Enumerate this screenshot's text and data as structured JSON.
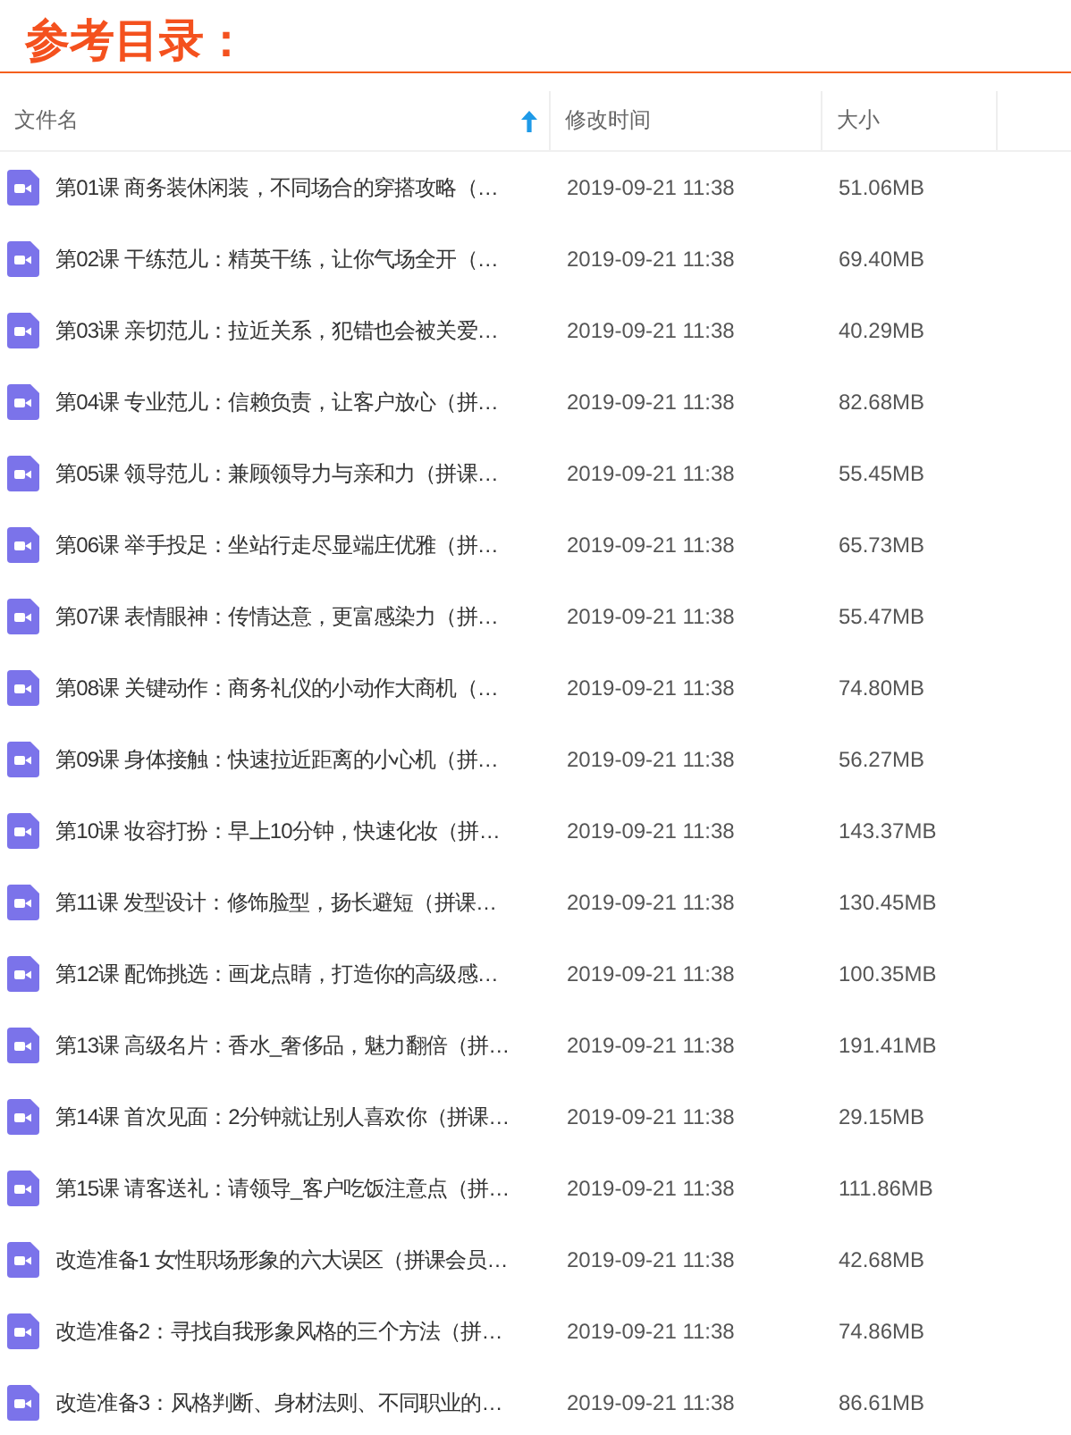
{
  "title": "参考目录：",
  "table": {
    "columns": [
      {
        "label": "文件名",
        "sorted": true
      },
      {
        "label": "修改时间",
        "sorted": false
      },
      {
        "label": "大小",
        "sorted": false
      }
    ],
    "rows": [
      {
        "name": "第01课 商务装休闲装，不同场合的穿搭攻略（…",
        "modified": "2019-09-21 11:38",
        "size": "51.06MB"
      },
      {
        "name": "第02课 干练范儿：精英干练，让你气场全开（…",
        "modified": "2019-09-21 11:38",
        "size": "69.40MB"
      },
      {
        "name": "第03课 亲切范儿：拉近关系，犯错也会被关爱…",
        "modified": "2019-09-21 11:38",
        "size": "40.29MB"
      },
      {
        "name": "第04课 专业范儿：信赖负责，让客户放心（拼…",
        "modified": "2019-09-21 11:38",
        "size": "82.68MB"
      },
      {
        "name": "第05课 领导范儿：兼顾领导力与亲和力（拼课…",
        "modified": "2019-09-21 11:38",
        "size": "55.45MB"
      },
      {
        "name": "第06课 举手投足：坐站行走尽显端庄优雅（拼…",
        "modified": "2019-09-21 11:38",
        "size": "65.73MB"
      },
      {
        "name": "第07课 表情眼神：传情达意，更富感染力（拼…",
        "modified": "2019-09-21 11:38",
        "size": "55.47MB"
      },
      {
        "name": "第08课 关键动作：商务礼仪的小动作大商机（…",
        "modified": "2019-09-21 11:38",
        "size": "74.80MB"
      },
      {
        "name": "第09课 身体接触：快速拉近距离的小心机（拼…",
        "modified": "2019-09-21 11:38",
        "size": "56.27MB"
      },
      {
        "name": "第10课 妆容打扮：早上10分钟，快速化妆（拼…",
        "modified": "2019-09-21 11:38",
        "size": "143.37MB"
      },
      {
        "name": "第11课 发型设计：修饰脸型，扬长避短（拼课…",
        "modified": "2019-09-21 11:38",
        "size": "130.45MB"
      },
      {
        "name": "第12课 配饰挑选：画龙点睛，打造你的高级感…",
        "modified": "2019-09-21 11:38",
        "size": "100.35MB"
      },
      {
        "name": "第13课 高级名片：香水_奢侈品，魅力翻倍（拼…",
        "modified": "2019-09-21 11:38",
        "size": "191.41MB"
      },
      {
        "name": "第14课 首次见面：2分钟就让别人喜欢你（拼课…",
        "modified": "2019-09-21 11:38",
        "size": "29.15MB"
      },
      {
        "name": "第15课 请客送礼：请领导_客户吃饭注意点（拼…",
        "modified": "2019-09-21 11:38",
        "size": "111.86MB"
      },
      {
        "name": "改造准备1 女性职场形象的六大误区（拼课会员…",
        "modified": "2019-09-21 11:38",
        "size": "42.68MB"
      },
      {
        "name": "改造准备2：寻找自我形象风格的三个方法（拼…",
        "modified": "2019-09-21 11:38",
        "size": "74.86MB"
      },
      {
        "name": "改造准备3：风格判断、身材法则、不同职业的…",
        "modified": "2019-09-21 11:38",
        "size": "86.61MB"
      }
    ]
  }
}
